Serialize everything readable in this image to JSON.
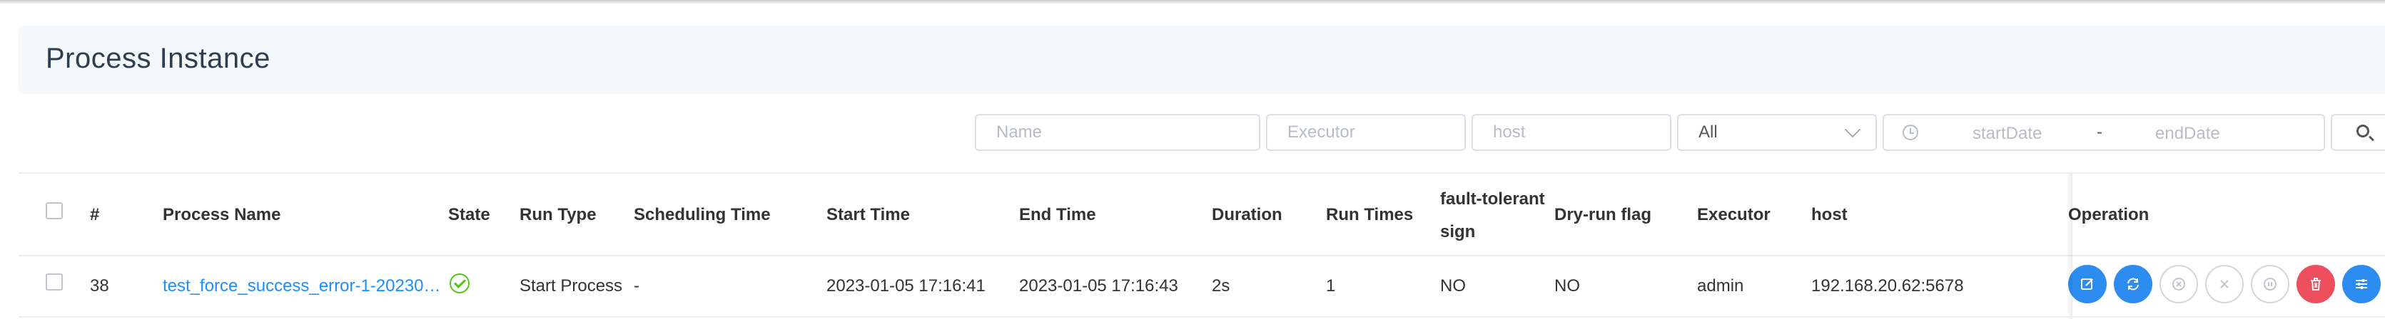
{
  "page": {
    "title": "Process Instance"
  },
  "filters": {
    "name_placeholder": "Name",
    "executor_placeholder": "Executor",
    "host_placeholder": "host",
    "state_select_value": "All",
    "start_date_placeholder": "startDate",
    "range_separator": "-",
    "end_date_placeholder": "endDate",
    "search_icon": "search-icon"
  },
  "table": {
    "columns": {
      "index": "#",
      "process_name": "Process Name",
      "state": "State",
      "run_type": "Run Type",
      "scheduling_time": "Scheduling Time",
      "start_time": "Start Time",
      "end_time": "End Time",
      "duration": "Duration",
      "run_times": "Run Times",
      "fault_tolerant_line1": "fault-tolerant",
      "fault_tolerant_line2": "sign",
      "dry_run_flag": "Dry-run flag",
      "executor": "Executor",
      "host": "host",
      "operation": "Operation"
    },
    "rows": [
      {
        "id": "38",
        "process_name": "test_force_success_error-1-20230…",
        "state_icon": "success-check-circle-icon",
        "run_type": "Start Process",
        "scheduling_time": "-",
        "start_time": "2023-01-05 17:16:41",
        "end_time": "2023-01-05 17:16:43",
        "duration": "2s",
        "run_times": "1",
        "fault_tolerant": "NO",
        "dry_run_flag": "NO",
        "executor": "admin",
        "host": "192.168.20.62:5678",
        "operations": [
          {
            "icon": "edit-icon",
            "color": "#2d8cf0",
            "enabled": true
          },
          {
            "icon": "rerun-icon",
            "color": "#2d8cf0",
            "enabled": true
          },
          {
            "icon": "recover-failed-icon",
            "color": "#d3d6db",
            "enabled": false
          },
          {
            "icon": "stop-icon",
            "color": "#d3d6db",
            "enabled": false
          },
          {
            "icon": "pause-icon",
            "color": "#d3d6db",
            "enabled": false
          },
          {
            "icon": "delete-icon",
            "color": "#ed4f5e",
            "enabled": true
          },
          {
            "icon": "gantt-icon",
            "color": "#2d8cf0",
            "enabled": true
          }
        ]
      }
    ]
  },
  "colors": {
    "link": "#1890ff",
    "success": "#52c41a",
    "primary": "#2d8cf0",
    "danger": "#ed4f5e",
    "title_bar_bg": "#f4f8fb"
  }
}
